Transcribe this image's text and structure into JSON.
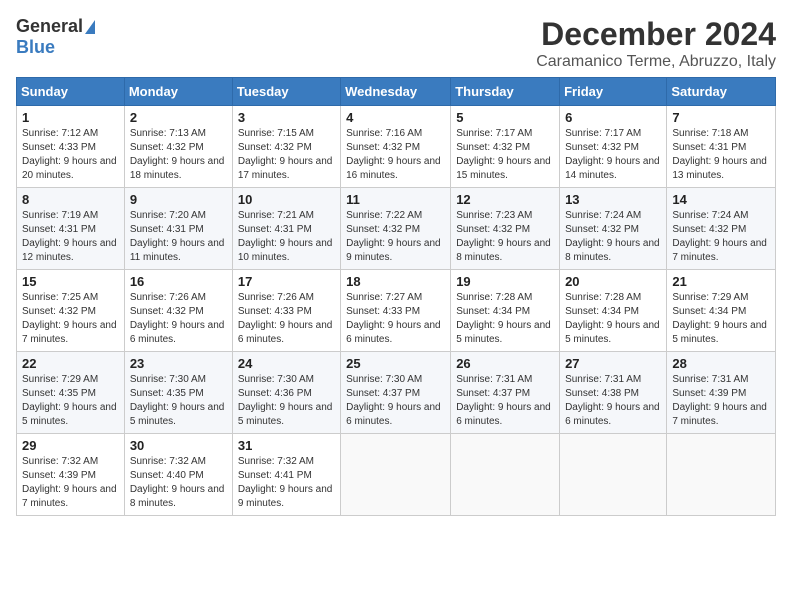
{
  "logo": {
    "general": "General",
    "blue": "Blue"
  },
  "title": "December 2024",
  "subtitle": "Caramanico Terme, Abruzzo, Italy",
  "days_of_week": [
    "Sunday",
    "Monday",
    "Tuesday",
    "Wednesday",
    "Thursday",
    "Friday",
    "Saturday"
  ],
  "weeks": [
    [
      {
        "day": "1",
        "sunrise": "7:12 AM",
        "sunset": "4:33 PM",
        "daylight": "9 hours and 20 minutes."
      },
      {
        "day": "2",
        "sunrise": "7:13 AM",
        "sunset": "4:32 PM",
        "daylight": "9 hours and 18 minutes."
      },
      {
        "day": "3",
        "sunrise": "7:15 AM",
        "sunset": "4:32 PM",
        "daylight": "9 hours and 17 minutes."
      },
      {
        "day": "4",
        "sunrise": "7:16 AM",
        "sunset": "4:32 PM",
        "daylight": "9 hours and 16 minutes."
      },
      {
        "day": "5",
        "sunrise": "7:17 AM",
        "sunset": "4:32 PM",
        "daylight": "9 hours and 15 minutes."
      },
      {
        "day": "6",
        "sunrise": "7:17 AM",
        "sunset": "4:32 PM",
        "daylight": "9 hours and 14 minutes."
      },
      {
        "day": "7",
        "sunrise": "7:18 AM",
        "sunset": "4:31 PM",
        "daylight": "9 hours and 13 minutes."
      }
    ],
    [
      {
        "day": "8",
        "sunrise": "7:19 AM",
        "sunset": "4:31 PM",
        "daylight": "9 hours and 12 minutes."
      },
      {
        "day": "9",
        "sunrise": "7:20 AM",
        "sunset": "4:31 PM",
        "daylight": "9 hours and 11 minutes."
      },
      {
        "day": "10",
        "sunrise": "7:21 AM",
        "sunset": "4:31 PM",
        "daylight": "9 hours and 10 minutes."
      },
      {
        "day": "11",
        "sunrise": "7:22 AM",
        "sunset": "4:32 PM",
        "daylight": "9 hours and 9 minutes."
      },
      {
        "day": "12",
        "sunrise": "7:23 AM",
        "sunset": "4:32 PM",
        "daylight": "9 hours and 8 minutes."
      },
      {
        "day": "13",
        "sunrise": "7:24 AM",
        "sunset": "4:32 PM",
        "daylight": "9 hours and 8 minutes."
      },
      {
        "day": "14",
        "sunrise": "7:24 AM",
        "sunset": "4:32 PM",
        "daylight": "9 hours and 7 minutes."
      }
    ],
    [
      {
        "day": "15",
        "sunrise": "7:25 AM",
        "sunset": "4:32 PM",
        "daylight": "9 hours and 7 minutes."
      },
      {
        "day": "16",
        "sunrise": "7:26 AM",
        "sunset": "4:32 PM",
        "daylight": "9 hours and 6 minutes."
      },
      {
        "day": "17",
        "sunrise": "7:26 AM",
        "sunset": "4:33 PM",
        "daylight": "9 hours and 6 minutes."
      },
      {
        "day": "18",
        "sunrise": "7:27 AM",
        "sunset": "4:33 PM",
        "daylight": "9 hours and 6 minutes."
      },
      {
        "day": "19",
        "sunrise": "7:28 AM",
        "sunset": "4:34 PM",
        "daylight": "9 hours and 5 minutes."
      },
      {
        "day": "20",
        "sunrise": "7:28 AM",
        "sunset": "4:34 PM",
        "daylight": "9 hours and 5 minutes."
      },
      {
        "day": "21",
        "sunrise": "7:29 AM",
        "sunset": "4:34 PM",
        "daylight": "9 hours and 5 minutes."
      }
    ],
    [
      {
        "day": "22",
        "sunrise": "7:29 AM",
        "sunset": "4:35 PM",
        "daylight": "9 hours and 5 minutes."
      },
      {
        "day": "23",
        "sunrise": "7:30 AM",
        "sunset": "4:35 PM",
        "daylight": "9 hours and 5 minutes."
      },
      {
        "day": "24",
        "sunrise": "7:30 AM",
        "sunset": "4:36 PM",
        "daylight": "9 hours and 5 minutes."
      },
      {
        "day": "25",
        "sunrise": "7:30 AM",
        "sunset": "4:37 PM",
        "daylight": "9 hours and 6 minutes."
      },
      {
        "day": "26",
        "sunrise": "7:31 AM",
        "sunset": "4:37 PM",
        "daylight": "9 hours and 6 minutes."
      },
      {
        "day": "27",
        "sunrise": "7:31 AM",
        "sunset": "4:38 PM",
        "daylight": "9 hours and 6 minutes."
      },
      {
        "day": "28",
        "sunrise": "7:31 AM",
        "sunset": "4:39 PM",
        "daylight": "9 hours and 7 minutes."
      }
    ],
    [
      {
        "day": "29",
        "sunrise": "7:32 AM",
        "sunset": "4:39 PM",
        "daylight": "9 hours and 7 minutes."
      },
      {
        "day": "30",
        "sunrise": "7:32 AM",
        "sunset": "4:40 PM",
        "daylight": "9 hours and 8 minutes."
      },
      {
        "day": "31",
        "sunrise": "7:32 AM",
        "sunset": "4:41 PM",
        "daylight": "9 hours and 9 minutes."
      },
      null,
      null,
      null,
      null
    ]
  ]
}
